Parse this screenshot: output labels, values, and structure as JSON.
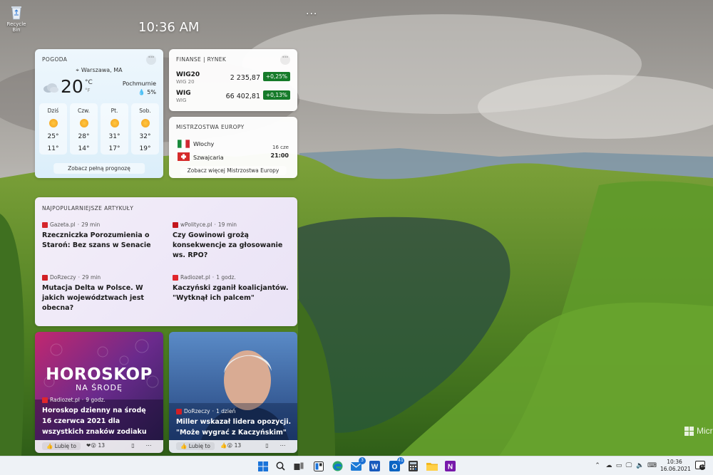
{
  "desktop": {
    "recycle_bin_label": "Recycle Bin",
    "board_time": "10:36 AM",
    "board_more": "···",
    "watermark": "Micr"
  },
  "weather": {
    "title": "POGODA",
    "more": "···",
    "location": "Warszawa, MA",
    "temperature": "20",
    "unit_c": "°C",
    "unit_f": "°F",
    "condition": "Pochmurnie",
    "precipitation": "5%",
    "days": [
      {
        "name": "Dziś",
        "high": "25°",
        "low": "11°"
      },
      {
        "name": "Czw.",
        "high": "28°",
        "low": "14°"
      },
      {
        "name": "Pt.",
        "high": "31°",
        "low": "17°"
      },
      {
        "name": "Sob.",
        "high": "32°",
        "low": "19°"
      }
    ],
    "forecast_button": "Zobacz pełną prognozę"
  },
  "finance": {
    "title": "FINANSE | RYNEK",
    "more": "···",
    "rows": [
      {
        "symbol": "WIG20",
        "subtitle": "WIG 20",
        "value": "2 235,87",
        "change": "+0,25%"
      },
      {
        "symbol": "WIG",
        "subtitle": "WIG",
        "value": "66 402,81",
        "change": "+0,13%"
      }
    ],
    "change_color": "#167b2a"
  },
  "euro": {
    "title": "MISTRZOSTWA EUROPY",
    "team1": "Włochy",
    "team2": "Szwajcaria",
    "date": "16 cze",
    "time": "21:00",
    "more_button": "Zobacz więcej Mistrzostwa Europy"
  },
  "articles": {
    "title": "NAJPOPULARNIEJSZE ARTYKUŁY",
    "items": [
      {
        "source": "Gazeta.pl",
        "time": "29 min",
        "title": "Rzeczniczka Porozumienia o Staroń: Bez szans w Senacie",
        "color": "#d5262b"
      },
      {
        "source": "wPolityce.pl",
        "time": "19 min",
        "title": "Czy Gowinowi grożą konsekwencje za głosowanie ws. RPO?",
        "color": "#c3161c"
      },
      {
        "source": "DoRzeczy",
        "time": "29 min",
        "title": "Mutacja Delta w Polsce. W jakich województwach jest obecna?",
        "color": "#d11f25"
      },
      {
        "source": "Radiozet.pl",
        "time": "1 godz.",
        "title": "Kaczyński zganił koalicjantów. \"Wytknął ich palcem\"",
        "color": "#e0262c"
      }
    ]
  },
  "horoscope": {
    "image_text_line1": "HOROSKOP",
    "image_text_line2": "NA ŚRODĘ",
    "source": "Radiozet.pl",
    "time": "9 godz.",
    "title": "Horoskop dzienny na środę 16 czerwca 2021 dla wszystkich znaków zodiaku",
    "like": "Lubię to",
    "reactions": "13"
  },
  "miller": {
    "source": "DoRzeczy",
    "time": "1 dzień",
    "title": "Miller wskazał lidera opozycji. \"Może wygrać z Kaczyńskim\"",
    "like": "Lubię to",
    "reactions": "13"
  },
  "taskbar": {
    "apps": [
      {
        "name": "start",
        "icon": "windows-logo"
      },
      {
        "name": "search",
        "icon": "search-icon"
      },
      {
        "name": "task-view",
        "icon": "task-view-icon"
      },
      {
        "name": "widgets",
        "icon": "widgets-icon"
      },
      {
        "name": "edge",
        "icon": "edge-icon"
      },
      {
        "name": "mail",
        "icon": "mail-icon",
        "badge": "3"
      },
      {
        "name": "word",
        "icon": "word-icon"
      },
      {
        "name": "outlook",
        "icon": "outlook-icon",
        "badge": "41"
      },
      {
        "name": "calculator",
        "icon": "calculator-icon"
      },
      {
        "name": "explorer",
        "icon": "folder-icon"
      },
      {
        "name": "onenote",
        "icon": "onenote-icon"
      }
    ],
    "time": "10:36",
    "date": "16.06.2021",
    "notifications": "11"
  }
}
